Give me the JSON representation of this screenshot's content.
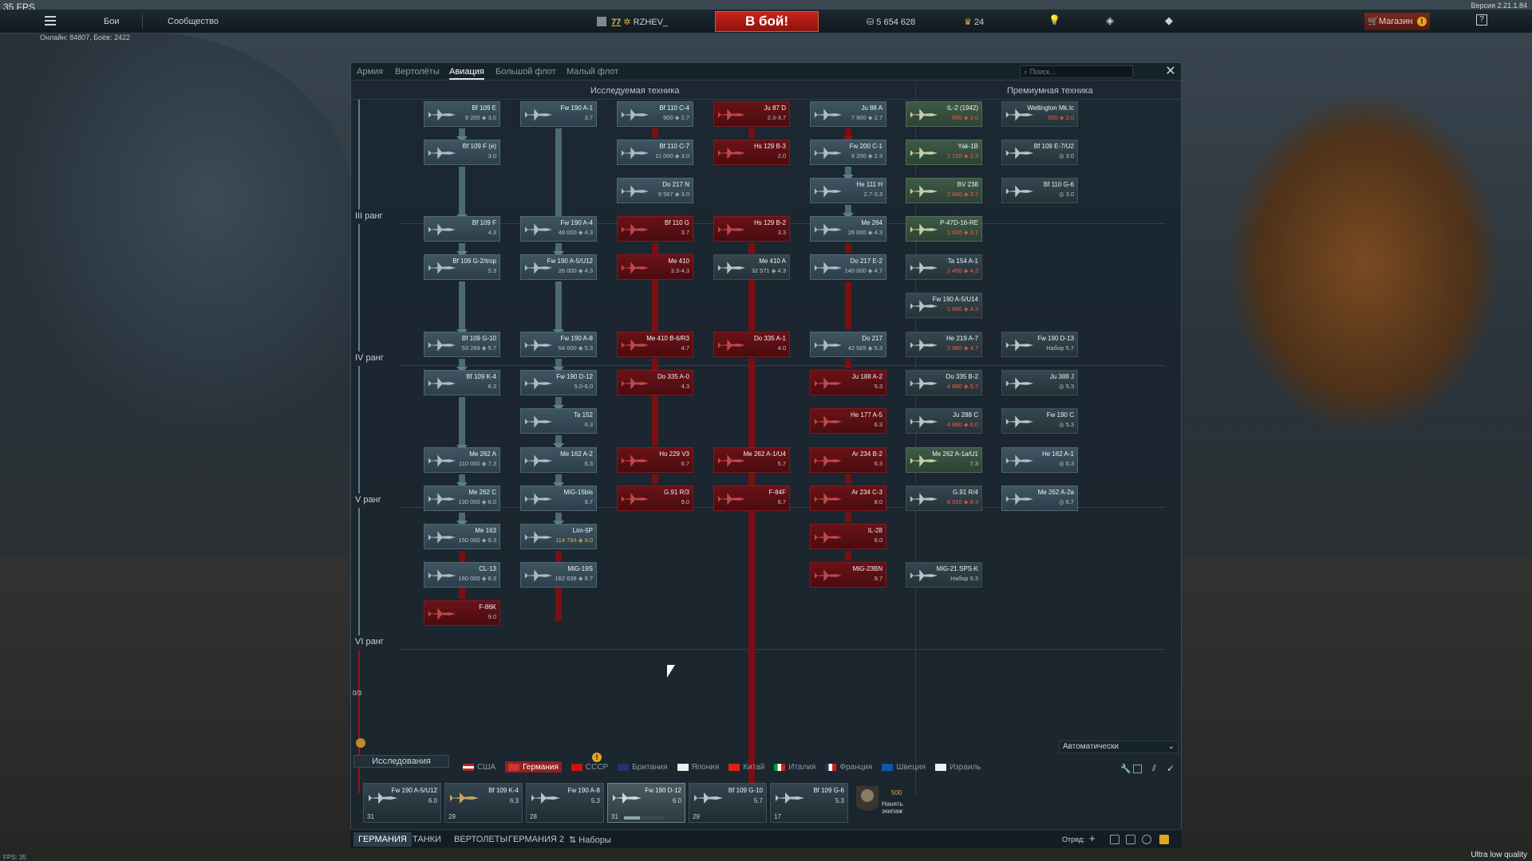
{
  "fps": "35 FPS",
  "version": "Версия 2.21.1.84",
  "online": "Онлайн: 84807, Боёв: 2422",
  "fps_small": "FPS: 35",
  "quality": "Ultra low quality",
  "topbar": {
    "battles": "Бои",
    "community": "Сообщество",
    "player_level": "77",
    "player_name": "RZHEV_",
    "battle_button": "В бой!",
    "silver": "5 654 628",
    "gold": "24",
    "shop": "Магазин"
  },
  "window": {
    "tabs": [
      "Армия",
      "Вертолёты",
      "Авиация",
      "Большой флот",
      "Малый флот"
    ],
    "search_placeholder": "Поиск...",
    "research_header": "Исследуемая техника",
    "premium_header": "Премиумная техника",
    "ranks": [
      "III ранг",
      "IV ранг",
      "V ранг",
      "VI ранг"
    ],
    "rank_counter": "0/3",
    "auto": "Автоматически"
  },
  "cards": [
    {
      "name": "Bf 109 E",
      "stat": "9 200 ◈ 3.0"
    },
    {
      "name": "Fw 190 A-1",
      "stat": "3.7"
    },
    {
      "name": "Bf 110 C-4",
      "stat": "900 ◈ 2.7"
    },
    {
      "name": "Ju 87 D",
      "stat": "2.3-3.7"
    },
    {
      "name": "Ju 88 A",
      "stat": "7 900 ◈ 2.7"
    },
    {
      "name": "IL-2 (1942)",
      "stat": "850 ◈ 3.0"
    },
    {
      "name": "Wellington Mk.Ic",
      "stat": "000 ◈ 2.0"
    },
    {
      "name": "Bf 109 F (e)",
      "stat": "3.0"
    },
    {
      "name": "Bf 110 C-7",
      "stat": "11 000 ◈ 3.0"
    },
    {
      "name": "Hs 129 B-3",
      "stat": "2.0"
    },
    {
      "name": "Fw 200 C-1",
      "stat": "9 200 ◈ 2.3"
    },
    {
      "name": "Yak-1B",
      "stat": "1 150 ◈ 3.3"
    },
    {
      "name": "Bf 109 E-7/U2",
      "stat": "◎ 3.0"
    },
    {
      "name": "Do 217 N",
      "stat": "9 567 ◈ 3.0"
    },
    {
      "name": "He 111 H",
      "stat": "2.7-3.3"
    },
    {
      "name": "BV 238",
      "stat": "1 840 ◈ 3.7"
    },
    {
      "name": "Bf 110 G-6",
      "stat": "◎ 3.0"
    },
    {
      "name": "Bf 109 F",
      "stat": "4.3"
    },
    {
      "name": "Fw 190 A-4",
      "stat": "48 000 ◈ 4.3"
    },
    {
      "name": "Bf 110 G",
      "stat": "3.7"
    },
    {
      "name": "Hs 129 B-2",
      "stat": "3.3"
    },
    {
      "name": "Me 264",
      "stat": "26 000 ◈ 4.3"
    },
    {
      "name": "P-47D-16-RE",
      "stat": "1 600 ◈ 3.7"
    },
    {
      "name": "Bf 109 G-2/trop",
      "stat": "5.3"
    },
    {
      "name": "Fw 190 A-5/U12",
      "stat": "26 000 ◈ 4.3"
    },
    {
      "name": "Me 410",
      "stat": "3.3-4.3"
    },
    {
      "name": "Me 410 A",
      "stat": "32 571 ◈ 4.3"
    },
    {
      "name": "Do 217 E-2",
      "stat": "140 000 ◈ 4.7"
    },
    {
      "name": "Ta 154 A-1",
      "stat": "1 450 ◈ 4.3"
    },
    {
      "name": "Fw 190 A-5/U14",
      "stat": "1 600 ◈ 4.3"
    },
    {
      "name": "Bf 109 G-10",
      "stat": "53 269 ◈ 5.7"
    },
    {
      "name": "Fw 190 A-8",
      "stat": "54 000 ◈ 5.3"
    },
    {
      "name": "Me 410 B-6/R3",
      "stat": "4.7"
    },
    {
      "name": "Do 335 A-1",
      "stat": "4.0"
    },
    {
      "name": "Do 217",
      "stat": "42 565 ◈ 5.3"
    },
    {
      "name": "He 219 A-7",
      "stat": "1 980 ◈ 4.7"
    },
    {
      "name": "Fw 190 D-13",
      "stat": "Набор 5.7"
    },
    {
      "name": "Bf 109 K-4",
      "stat": "6.3"
    },
    {
      "name": "Fw 190 D-12",
      "stat": "5.0-6.0"
    },
    {
      "name": "Do 335 A-0",
      "stat": "4.3"
    },
    {
      "name": "Ju 188 A-2",
      "stat": "5.3"
    },
    {
      "name": "Do 335 B-2",
      "stat": "4 880 ◈ 5.7"
    },
    {
      "name": "Ju 388 J",
      "stat": "◎ 5.3"
    },
    {
      "name": "Ta 152",
      "stat": "6.3"
    },
    {
      "name": "He 177 A-5",
      "stat": "6.3"
    },
    {
      "name": "Ju 288 C",
      "stat": "4 880 ◈ 6.0"
    },
    {
      "name": "Fw 190 C",
      "stat": "◎ 5.3"
    },
    {
      "name": "Me 262 A",
      "stat": "110 000 ◈ 7.3"
    },
    {
      "name": "Me 162 A-2",
      "stat": "6.3"
    },
    {
      "name": "Ho 229 V3",
      "stat": "6.7"
    },
    {
      "name": "Me 262 A-1/U4",
      "stat": "5.7"
    },
    {
      "name": "Ar 234 B-2",
      "stat": "6.3"
    },
    {
      "name": "Me 262 A-1a/U1",
      "stat": "7.3"
    },
    {
      "name": "He 162 A-1",
      "stat": "◎ 6.3"
    },
    {
      "name": "Me 262 C",
      "stat": "130 000 ◈ 8.0"
    },
    {
      "name": "MiG-15bis",
      "stat": "8.7"
    },
    {
      "name": "G.91 R/3",
      "stat": "9.0"
    },
    {
      "name": "F-84F",
      "stat": "8.7"
    },
    {
      "name": "Ar 234 C-3",
      "stat": "8.0"
    },
    {
      "name": "G.91 R/4",
      "stat": "8 910 ◈ 8.3"
    },
    {
      "name": "Me 262 A-2a",
      "stat": "◎ 6.7"
    },
    {
      "name": "Me 163",
      "stat": "150 000 ◈ 9.3"
    },
    {
      "name": "Lim-5P",
      "stat": "114 794 ◈ 9.0"
    },
    {
      "name": "IL-28",
      "stat": "8.0"
    },
    {
      "name": "CL-13",
      "stat": "180 000 ◈ 8.3"
    },
    {
      "name": "MiG-19S",
      "stat": "162 638 ◈ 9.7"
    },
    {
      "name": "MiG-23BN",
      "stat": "9.7"
    },
    {
      "name": "MiG-21 SPS-K",
      "stat": "Набор 9.3"
    },
    {
      "name": "F-86K",
      "stat": "9.0"
    }
  ],
  "bottom": {
    "research_label": "Исследования",
    "nations": [
      "США",
      "Германия",
      "СССР",
      "Британия",
      "Япония",
      "Китай",
      "Италия",
      "Франция",
      "Швеция",
      "Израиль"
    ],
    "crew": [
      {
        "name": "Fw 190 A-5/U12",
        "br": "6.0",
        "crew": "31"
      },
      {
        "name": "Bf 109 K-4",
        "br": "6.3",
        "crew": "29"
      },
      {
        "name": "Fw 190 A-8",
        "br": "5.3",
        "crew": "28"
      },
      {
        "name": "Fw 190 D-12",
        "br": "6.0",
        "crew": "31"
      },
      {
        "name": "Bf 109 G-10",
        "br": "5.7",
        "crew": "29"
      },
      {
        "name": "Bf 109 G-6",
        "br": "5.3",
        "crew": "17"
      }
    ],
    "buy_price": "500",
    "buy_label": "Нанять экипаж",
    "footer_tabs": [
      "ГЕРМАНИЯ",
      "ТАНКИ",
      "ВЕРТОЛЕТЫ",
      "ГЕРМАНИЯ 2",
      "Наборы"
    ],
    "squad": "Отряд:"
  },
  "colors": {
    "accent_red": "#c8231b",
    "premium_gold": "#e0a94b",
    "tree_line": "#5b7f88"
  }
}
